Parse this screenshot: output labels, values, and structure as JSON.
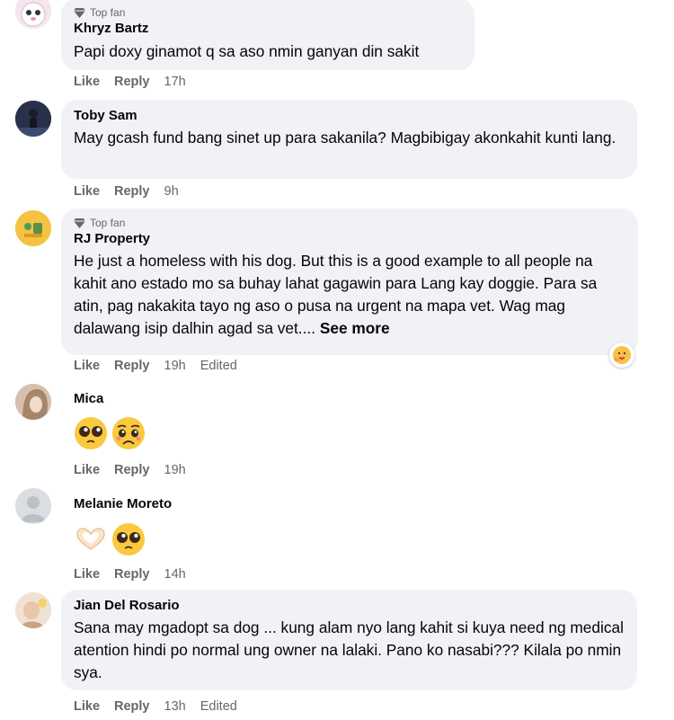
{
  "comments": [
    {
      "badge": "Top fan",
      "author": "Khryz Bartz",
      "text": "Papi doxy ginamot q sa aso nmin ganyan din sakit",
      "like": "Like",
      "reply": "Reply",
      "time": "17h"
    },
    {
      "author": "Toby Sam",
      "text": "May gcash fund bang sinet up para sakanila? Magbibigay akonkahit kunti lang.",
      "like": "Like",
      "reply": "Reply",
      "time": "9h"
    },
    {
      "badge": "Top fan",
      "author": "RJ Property",
      "text": "He just a homeless with his dog. But this is a good example to all people na kahit ano estado mo sa buhay lahat gagawin para Lang kay doggie. Para sa atin, pag nakakita tayo ng aso o pusa na urgent na mapa vet. Wag mag dalawang isip dalhin agad sa vet....",
      "see_more": "See more",
      "like": "Like",
      "reply": "Reply",
      "time": "19h",
      "edited": "Edited"
    },
    {
      "author": "Mica",
      "like": "Like",
      "reply": "Reply",
      "time": "19h"
    },
    {
      "author": "Melanie Moreto",
      "like": "Like",
      "reply": "Reply",
      "time": "14h"
    },
    {
      "author": "Jian Del Rosario",
      "text": "Sana may mgadopt sa dog ... kung alam nyo lang kahit si kuya need ng medical atention hindi po normal ung owner na lalaki. Pano ko nasabi??? Kilala po nmin sya.",
      "like": "Like",
      "reply": "Reply",
      "time": "13h",
      "edited": "Edited"
    }
  ],
  "colors": {
    "bubble": "#f0f2f5",
    "meta_text": "#65676b",
    "text": "#050505"
  }
}
